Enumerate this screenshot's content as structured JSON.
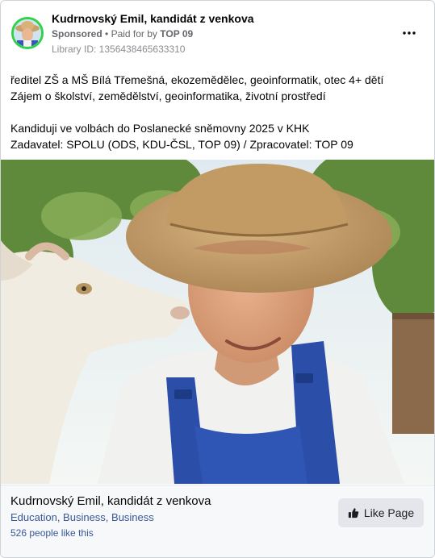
{
  "header": {
    "page_name": "Kudrnovský Emil, kandidát z venkova",
    "sponsored": "Sponsored",
    "separator": "•",
    "paid_for_by": "Paid for by",
    "payer": "TOP 09",
    "library_id": "Library ID: 1356438465633310",
    "more_icon": "more-horizontal-icon"
  },
  "body": {
    "lines": [
      "ředitel ZŠ a MŠ Bílá Třemešná, ekozemědělec, geoinformatik, otec 4+ dětí",
      "Zájem o školství, zemědělství, geoinformatika, životní prostředí",
      "Kandiduji ve volbách do Poslanecké sněmovny 2025 v KHK",
      "Zadavatel: SPOLU (ODS, KDU-ČSL, TOP 09) / Zpracovatel: TOP 09"
    ]
  },
  "footer": {
    "title": "Kudrnovský Emil, kandidát z venkova",
    "categories": "Education, Business, Business",
    "likes": "526 people like this",
    "like_button": "Like Page",
    "like_icon": "thumbs-up-icon"
  },
  "colors": {
    "avatar_ring": "#2fd24a",
    "link": "#385898",
    "secondary_text": "#65676b"
  }
}
